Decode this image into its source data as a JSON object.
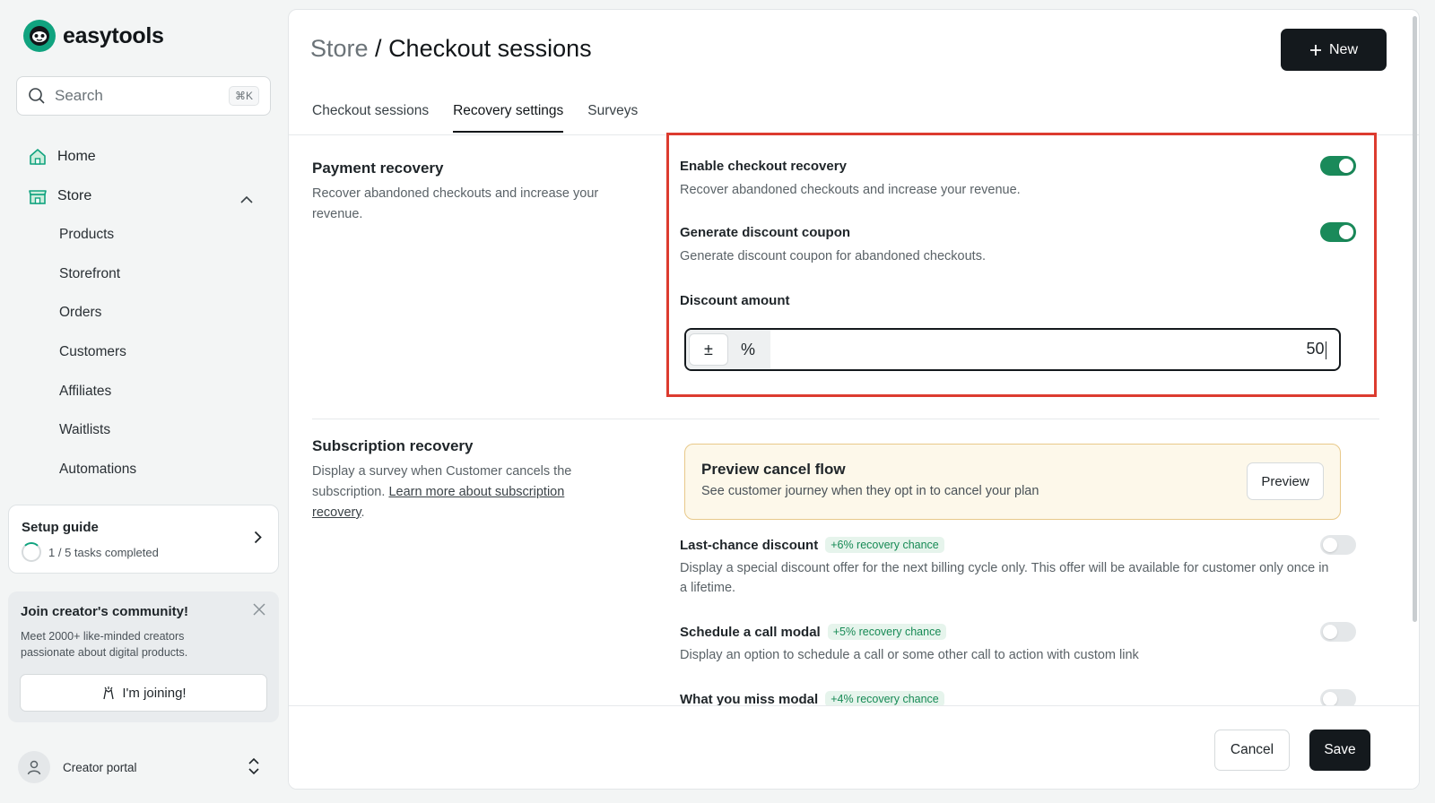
{
  "brand": {
    "name": "easytools"
  },
  "search": {
    "placeholder": "Search",
    "shortcut": "⌘K"
  },
  "sidebar": {
    "home": "Home",
    "store": "Store",
    "store_items": [
      "Products",
      "Storefront",
      "Orders",
      "Customers",
      "Affiliates",
      "Waitlists",
      "Automations"
    ]
  },
  "setup_guide": {
    "title": "Setup guide",
    "progress": "1 / 5 tasks completed",
    "completed": 1,
    "total": 5
  },
  "community": {
    "title": "Join creator's community!",
    "text": "Meet 2000+ like-minded creators passionate about digital products.",
    "button": "I'm joining!"
  },
  "portal": {
    "label": "Creator portal"
  },
  "header": {
    "crumb": "Store",
    "separator": " / ",
    "title": "Checkout sessions",
    "new_button": "New"
  },
  "tabs": [
    "Checkout sessions",
    "Recovery settings",
    "Surveys"
  ],
  "payment_recovery": {
    "title": "Payment recovery",
    "description": "Recover abandoned checkouts and increase your revenue.",
    "enable": {
      "label": "Enable checkout recovery",
      "description": "Recover abandoned checkouts and increase your revenue.",
      "on": true
    },
    "coupon": {
      "label": "Generate discount coupon",
      "description": "Generate discount coupon for abandoned checkouts.",
      "on": true
    },
    "amount": {
      "label": "Discount amount",
      "mode_fixed": "±",
      "mode_percent": "%",
      "value": "50"
    }
  },
  "subscription_recovery": {
    "title": "Subscription recovery",
    "description": "Display a survey when Customer cancels the subscription.",
    "link": "Learn more about subscription recovery",
    "trailing": ".",
    "preview": {
      "title": "Preview cancel flow",
      "subtitle": "See customer journey when they opt in to cancel your plan",
      "button": "Preview"
    },
    "options": [
      {
        "label": "Last-chance discount",
        "badge": "+6% recovery chance",
        "description": "Display a special discount offer for the next billing cycle only. This offer will be available for customer only once in a lifetime.",
        "on": false
      },
      {
        "label": "Schedule a call modal",
        "badge": "+5% recovery chance",
        "description": "Display an option to schedule a call or some other call to action with custom link",
        "on": false
      },
      {
        "label": "What you miss modal",
        "badge": "+4% recovery chance",
        "on": false
      }
    ]
  },
  "footer": {
    "cancel": "Cancel",
    "save": "Save"
  },
  "colors": {
    "accent": "#1a8a5a",
    "primary": "#14191d",
    "highlight": "#dc3b2f",
    "preview_bg": "#fdf8ea"
  }
}
